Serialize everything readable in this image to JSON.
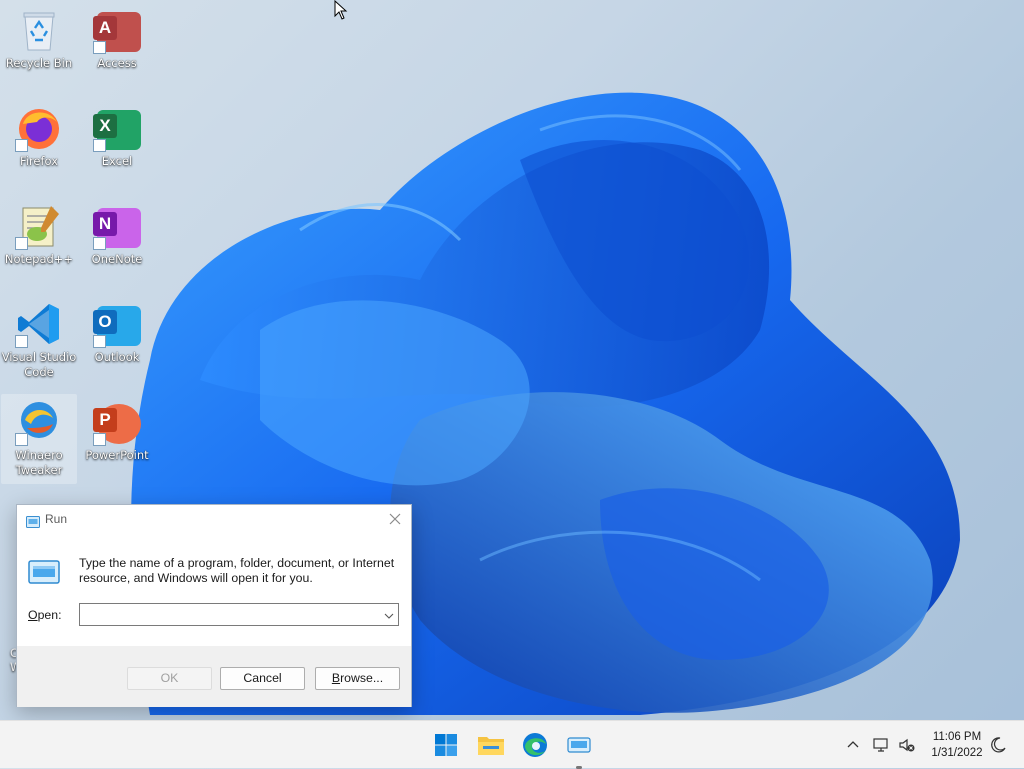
{
  "desktop": {
    "icons": [
      {
        "label": "Recycle Bin",
        "icon": "recycle-bin-icon"
      },
      {
        "label": "Access",
        "icon": "access-icon",
        "letter": "A",
        "color": "#a4373a"
      },
      {
        "label": "Firefox",
        "icon": "firefox-icon"
      },
      {
        "label": "Excel",
        "icon": "excel-icon",
        "letter": "X",
        "color": "#1d6f42"
      },
      {
        "label": "Notepad++",
        "icon": "notepad-plus-plus-icon"
      },
      {
        "label": "OneNote",
        "icon": "onenote-icon",
        "letter": "N",
        "color": "#7719aa"
      },
      {
        "label": "Visual Studio Code",
        "icon": "vscode-icon"
      },
      {
        "label": "Outlook",
        "icon": "outlook-icon",
        "letter": "O",
        "color": "#0f6cbd"
      },
      {
        "label": "Winaero Tweaker",
        "icon": "winaero-tweaker-icon",
        "selected": true
      },
      {
        "label": "PowerPoint",
        "icon": "powerpoint-icon",
        "letter": "P",
        "color": "#c43e1c"
      }
    ],
    "partial_labels": [
      "C",
      "W"
    ]
  },
  "run_dialog": {
    "title": "Run",
    "description": "Type the name of a program, folder, document, or Internet resource, and Windows will open it for you.",
    "open_label": "Open:",
    "open_value": "",
    "buttons": {
      "ok": "OK",
      "cancel": "Cancel",
      "browse": "Browse..."
    }
  },
  "taskbar": {
    "pinned": [
      "start-icon",
      "file-explorer-icon",
      "edge-icon",
      "run-icon"
    ],
    "clock": {
      "time": "11:06 PM",
      "date": "1/31/2022"
    },
    "tray": [
      "show-hidden-icons-chevron-icon",
      "network-icon",
      "volume-muted-icon",
      "night-light-icon"
    ]
  },
  "colors": {
    "accent": "#0067c0",
    "wallpaper_bloom": "#1565e8",
    "taskbar": "#f3f3f3"
  }
}
